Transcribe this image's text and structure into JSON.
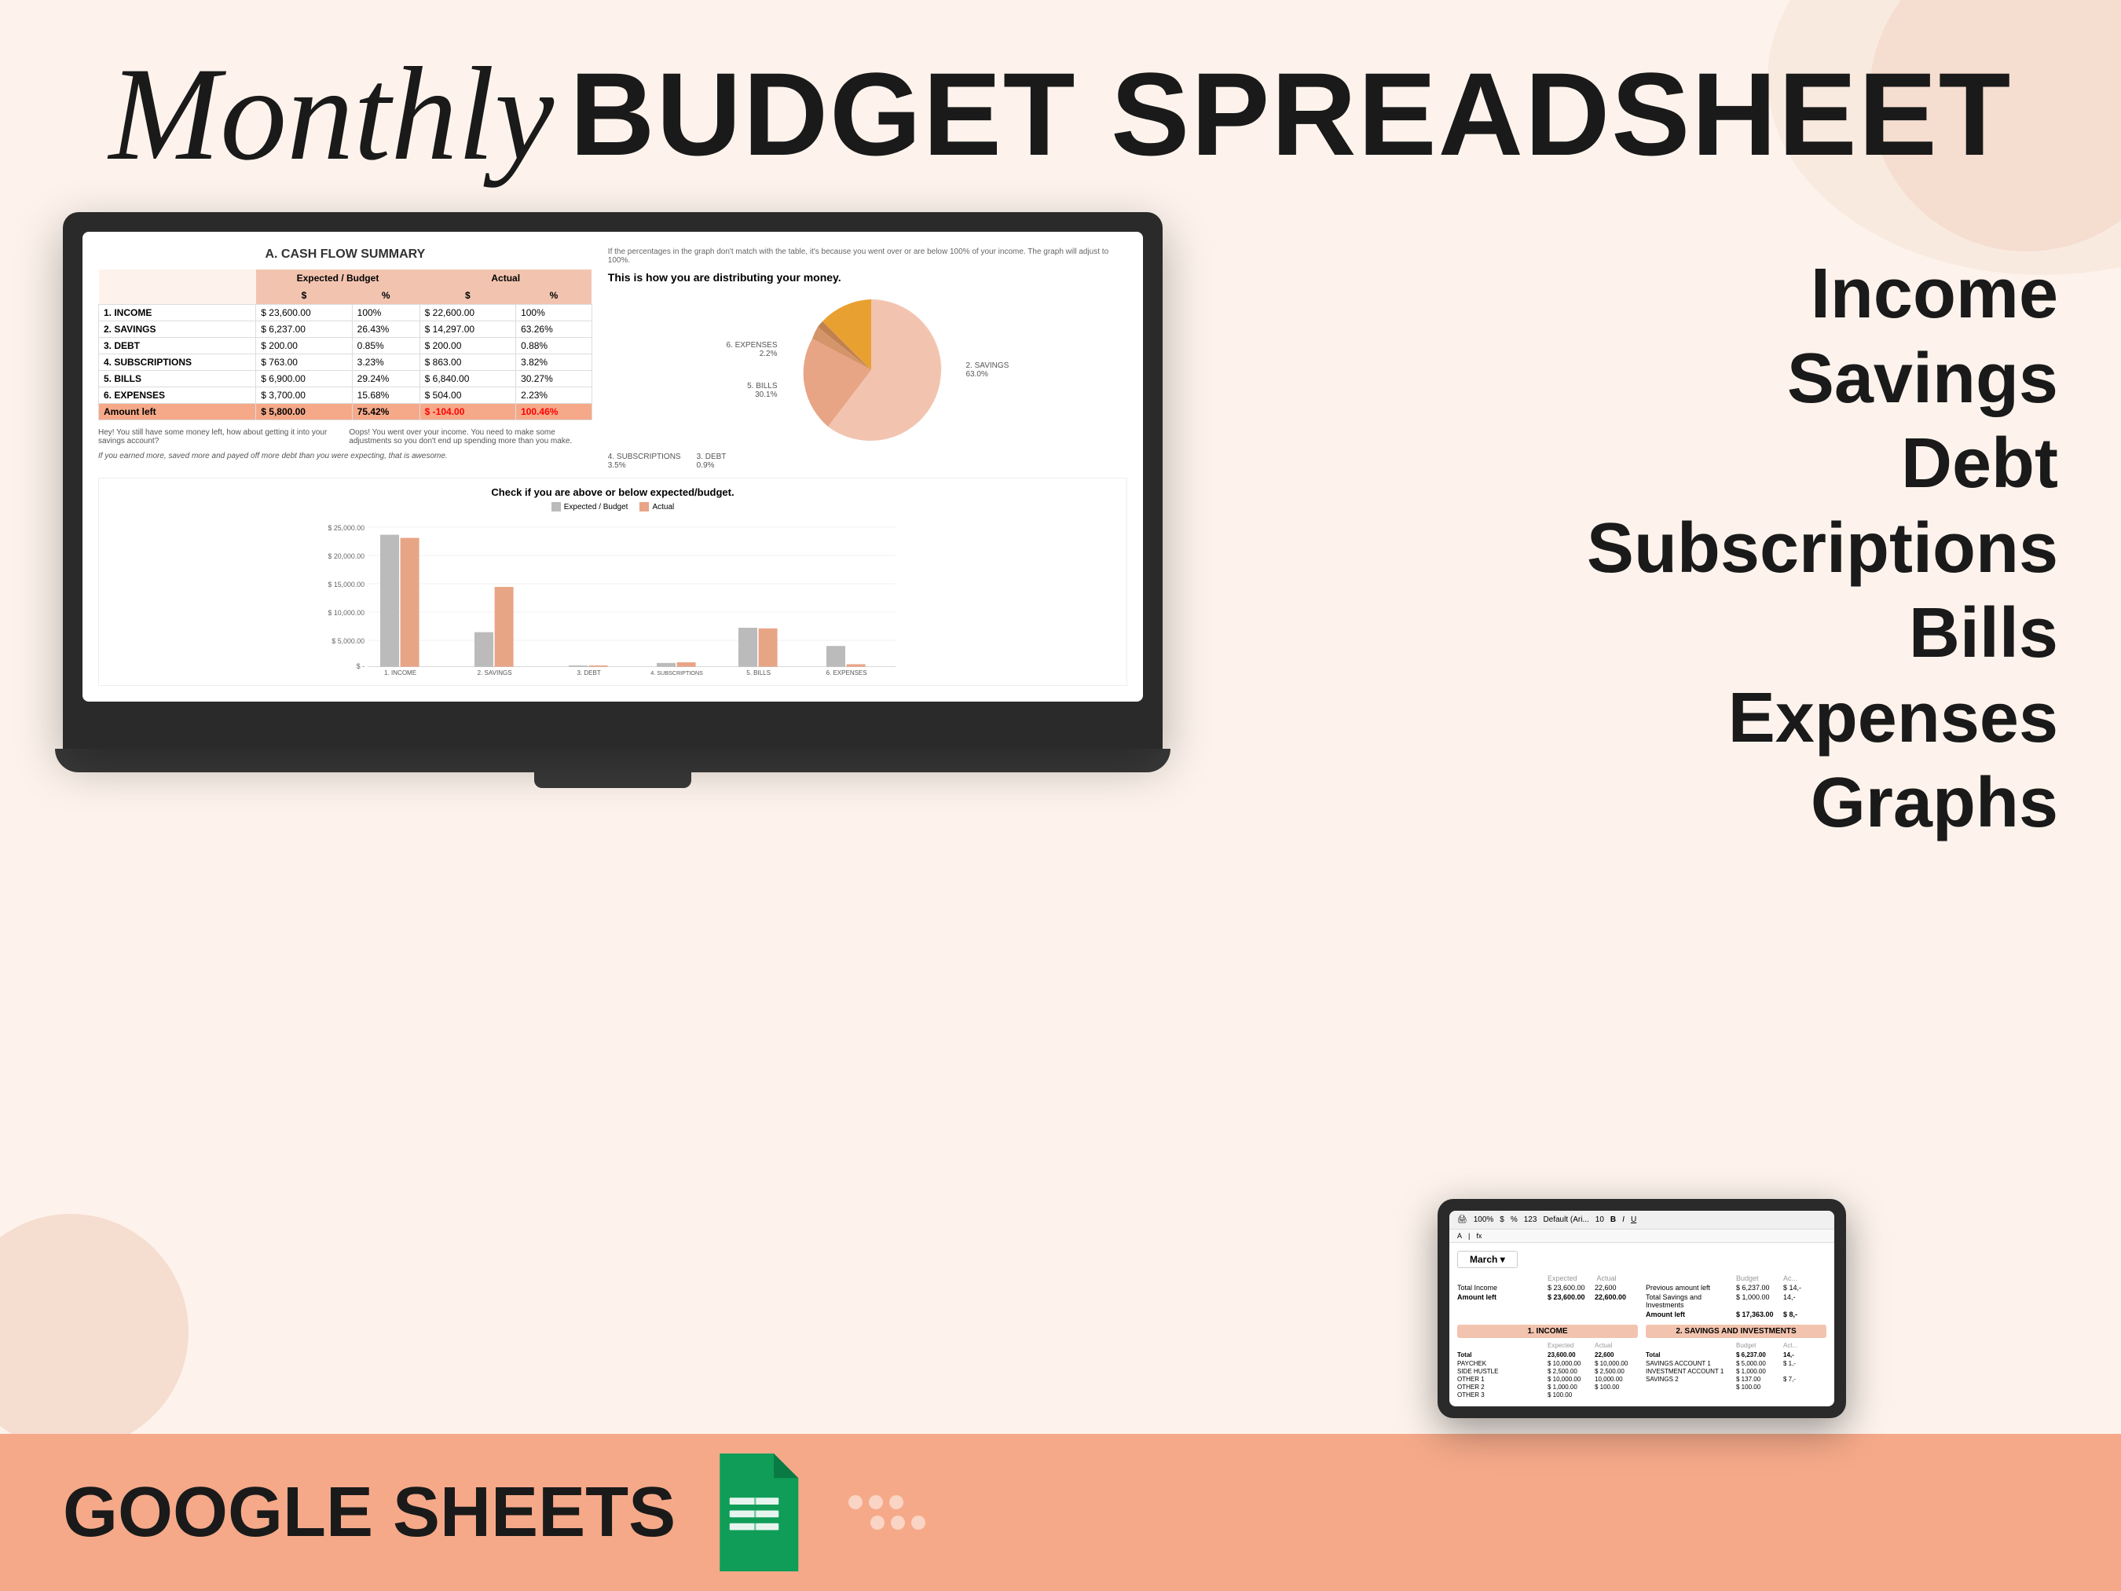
{
  "header": {
    "monthly": "Monthly",
    "budget_spreadsheet": "BUDGET SPREADSHEET"
  },
  "features": {
    "items": [
      "Income",
      "Savings",
      "Debt",
      "Subscriptions",
      "Bills",
      "Expenses",
      "Graphs"
    ]
  },
  "laptop": {
    "cash_flow": {
      "title": "A. CASH FLOW SUMMARY",
      "col_headers": [
        "",
        "Expected / Budget",
        "",
        "Actual",
        ""
      ],
      "sub_headers": [
        "",
        "$",
        "%",
        "$",
        "%"
      ],
      "rows": [
        {
          "label": "1. INCOME",
          "exp_val": "23,600.00",
          "exp_pct": "100%",
          "act_val": "22,600.00",
          "act_pct": "100%"
        },
        {
          "label": "2. SAVINGS",
          "exp_val": "6,237.00",
          "exp_pct": "26.43%",
          "act_val": "14,297.00",
          "act_pct": "63.26%"
        },
        {
          "label": "3. DEBT",
          "exp_val": "200.00",
          "exp_pct": "0.85%",
          "act_val": "200.00",
          "act_pct": "0.88%"
        },
        {
          "label": "4. SUBSCRIPTIONS",
          "exp_val": "763.00",
          "exp_pct": "3.23%",
          "act_val": "863.00",
          "act_pct": "3.82%"
        },
        {
          "label": "5. BILLS",
          "exp_val": "6,900.00",
          "exp_pct": "29.24%",
          "act_val": "6,840.00",
          "act_pct": "30.27%"
        },
        {
          "label": "6. EXPENSES",
          "exp_val": "3,700.00",
          "exp_pct": "15.68%",
          "act_val": "504.00",
          "act_pct": "2.23%"
        }
      ],
      "amount_left": {
        "label": "Amount left",
        "exp_val": "5,800.00",
        "exp_pct": "75.42%",
        "act_val": "-104.00",
        "act_pct": "100.46%"
      }
    },
    "pie": {
      "title": "This is how you are distributing your money.",
      "note": "If the percentages in the graph don't match with the table, it's because you went over or are below 100% of your income. The graph will adjust to 100%.",
      "labels": [
        {
          "name": "6. EXPENSES",
          "pct": "2.2%",
          "side": "left"
        },
        {
          "name": "5. BILLS",
          "pct": "30.1%",
          "side": "left"
        },
        {
          "name": "4. SUBSCRIPTIONS",
          "pct": "3.5%",
          "side": "left"
        },
        {
          "name": "3. DEBT",
          "pct": "0.9%",
          "side": "left"
        },
        {
          "name": "2. SAVINGS",
          "pct": "63.0%",
          "side": "right"
        }
      ]
    },
    "notes": {
      "positive": "Hey! You still have some money left, how about getting it into your savings account?",
      "negative": "Oops! You went over your income. You need to make some adjustments so you don't end up spending more than you make.",
      "footer": "If you earned more, saved more and payed off more debt than you were expecting, that is awesome."
    },
    "bar_chart": {
      "title": "Check if you are above or below expected/budget.",
      "legend": [
        "Expected / Budget",
        "Actual"
      ],
      "categories": [
        "1. INCOME",
        "2. SAVINGS",
        "3. DEBT",
        "4. SUBSCRIPTIONS",
        "5. BILLS",
        "6. EXPENSES"
      ],
      "expected": [
        23600,
        6237,
        200,
        763,
        6900,
        3700
      ],
      "actual": [
        22600,
        14297,
        200,
        863,
        6840,
        504
      ]
    }
  },
  "tablet": {
    "month": "March",
    "toolbar_zoom": "100%",
    "summary_left": {
      "total_income_label": "Total Income",
      "total_income_exp": "$ 23,600.00",
      "total_income_act": "22,600",
      "amount_left_label": "Amount left",
      "amount_left_exp": "$ 23,600.00",
      "amount_left_act": "22,600.00"
    },
    "summary_right": {
      "prev_amount_label": "Previous amount left",
      "prev_budget": "$ 6,237.00",
      "prev_act": "$ 14,-",
      "total_savings_label": "Total Savings and Investments",
      "total_savings_budget": "$ 1,000.00",
      "total_savings_act": "14,-",
      "amount_left_label": "Amount left",
      "amount_left_budget": "$ 17,363.00",
      "amount_left_act": "$ 8,-"
    },
    "income_section": {
      "title": "1. INCOME",
      "rows": [
        {
          "label": "Total",
          "exp": "23,600.00",
          "act": "22,600"
        },
        {
          "label": "PAYCHEK",
          "exp": "$ 10,000.00",
          "act": "$ 10,000.00"
        },
        {
          "label": "SIDE HUSTLE",
          "exp": "$ 2,500.00",
          "act": "$ 2,500.00"
        },
        {
          "label": "OTHER 1",
          "exp": "$ 10,000.00",
          "act": "10,000.00"
        },
        {
          "label": "OTHER 2",
          "exp": "$ 1,000.00",
          "act": "$ 100.00"
        },
        {
          "label": "OTHER 3",
          "exp": "$ 100.00",
          "act": ""
        }
      ]
    },
    "savings_section": {
      "title": "2. SAVINGS AND INVESTMENTS",
      "rows": [
        {
          "label": "Total",
          "budget": "$ 6,237.00",
          "act": "14,-"
        },
        {
          "label": "SAVINGS ACCOUNT 1",
          "budget": "$ 5,000.00",
          "act": "$ 1,-"
        },
        {
          "label": "INVESTMENT ACCOUNT 1",
          "budget": "$ 1,000.00",
          "act": ""
        },
        {
          "label": "SAVINGS 2",
          "budget": "$ 137.00",
          "act": "$ 7,-"
        },
        {
          "label": "",
          "budget": "$ 100.00",
          "act": ""
        }
      ]
    }
  },
  "bottom_bar": {
    "label": "GOOGLE SHEETS"
  }
}
